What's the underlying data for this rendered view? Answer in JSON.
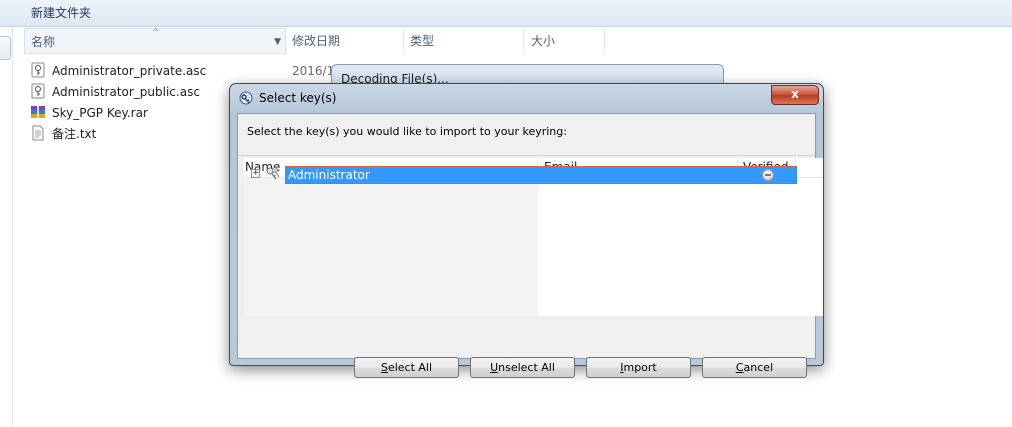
{
  "explorer": {
    "folder_title": "新建文件夹",
    "columns": {
      "name": "名称",
      "date": "修改日期",
      "type": "类型",
      "size": "大小"
    },
    "files": [
      {
        "name": "Administrator_private.asc",
        "date": "2016/1",
        "icon": "key-file-icon"
      },
      {
        "name": "Administrator_public.asc",
        "icon": "key-file-icon"
      },
      {
        "name": "Sky_PGP Key.rar",
        "icon": "rar-archive-icon"
      },
      {
        "name": "备注.txt",
        "icon": "text-file-icon"
      }
    ]
  },
  "background_dialog": {
    "title": "Decoding File(s)..."
  },
  "dialog": {
    "title": "Select key(s)",
    "close_label": "x",
    "instruction": "Select the key(s) you would like to import to your keyring:",
    "columns": {
      "name": "Name",
      "email": "Email",
      "verified": "Verified"
    },
    "keys": [
      {
        "name": "Administrator",
        "email": "",
        "verified": "none",
        "selected": true
      }
    ],
    "buttons": {
      "select_all": {
        "mnemonic": "S",
        "rest": "elect All"
      },
      "unselect_all": {
        "mnemonic": "U",
        "rest": "nselect All"
      },
      "import": {
        "mnemonic": "I",
        "rest": "mport"
      },
      "cancel": {
        "mnemonic": "C",
        "rest": "ancel"
      }
    }
  },
  "colors": {
    "selection": "#3399ff",
    "close_button": "#c7523b",
    "dialog_frame": "#b9c8da"
  }
}
